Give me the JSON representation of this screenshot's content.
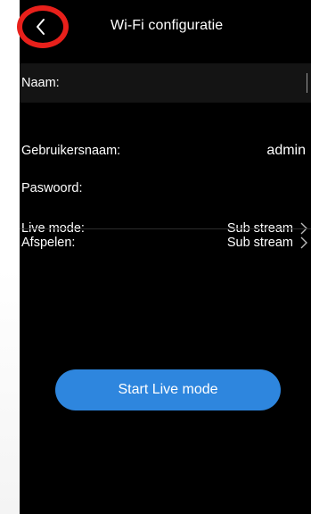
{
  "header": {
    "title": "Wi-Fi configuratie",
    "back_icon": "chevron-left-icon"
  },
  "form": {
    "name_label": "Naam:",
    "name_value": "",
    "username_label": "Gebruikersnaam:",
    "username_value": "admin",
    "password_label": "Paswoord:",
    "password_value": "",
    "live_mode_label": "Live mode:",
    "live_mode_value": "Sub stream",
    "playback_label": "Afspelen:",
    "playback_value": "Sub stream"
  },
  "actions": {
    "start_label": "Start Live mode"
  },
  "colors": {
    "background": "#000000",
    "accent": "#2e86de",
    "annotation": "#e8201b"
  }
}
